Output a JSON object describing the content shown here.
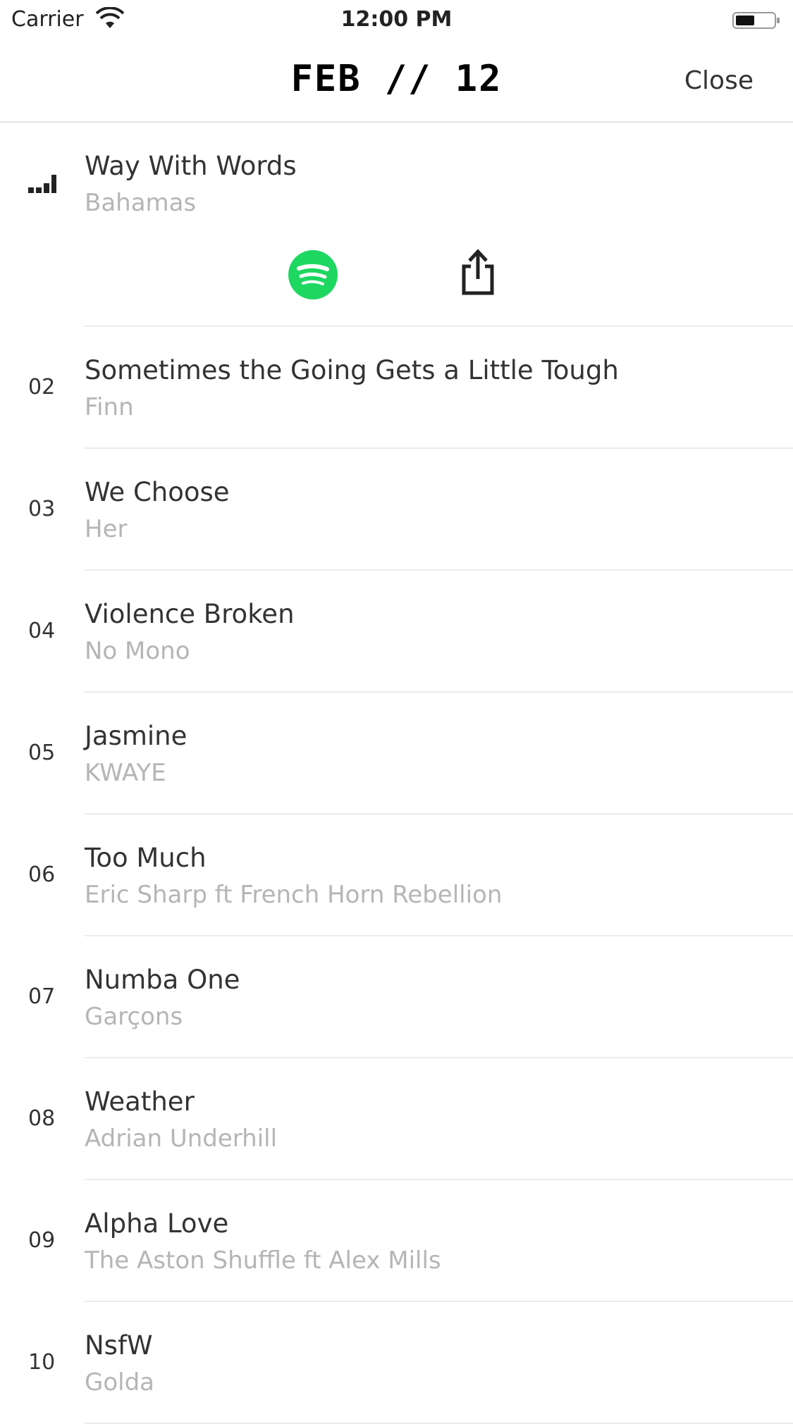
{
  "status_bar": {
    "carrier": "Carrier",
    "time": "12:00 PM"
  },
  "nav": {
    "title": "FEB // 12",
    "close_label": "Close"
  },
  "now_playing": {
    "title": "Way With Words",
    "artist": "Bahamas"
  },
  "tracks": [
    {
      "number": "02",
      "title": "Sometimes the Going Gets a Little Tough",
      "artist": "Finn"
    },
    {
      "number": "03",
      "title": "We Choose",
      "artist": "Her"
    },
    {
      "number": "04",
      "title": "Violence Broken",
      "artist": "No Mono"
    },
    {
      "number": "05",
      "title": "Jasmine",
      "artist": "KWAYE"
    },
    {
      "number": "06",
      "title": "Too Much",
      "artist": "Eric Sharp ft French Horn Rebellion"
    },
    {
      "number": "07",
      "title": "Numba One",
      "artist": "Garçons"
    },
    {
      "number": "08",
      "title": "Weather",
      "artist": "Adrian Underhill"
    },
    {
      "number": "09",
      "title": "Alpha Love",
      "artist": "The Aston Shuffle ft Alex Mills"
    },
    {
      "number": "10",
      "title": "NsfW",
      "artist": "Golda"
    }
  ],
  "colors": {
    "spotify_green": "#1ed760",
    "text": "#333333",
    "subtext": "#b5b5b5",
    "separator": "#ebebeb"
  },
  "icons": {
    "wifi": "wifi-icon",
    "battery": "battery-icon",
    "equalizer": "equalizer-icon",
    "spotify": "spotify-icon",
    "share": "share-icon"
  }
}
